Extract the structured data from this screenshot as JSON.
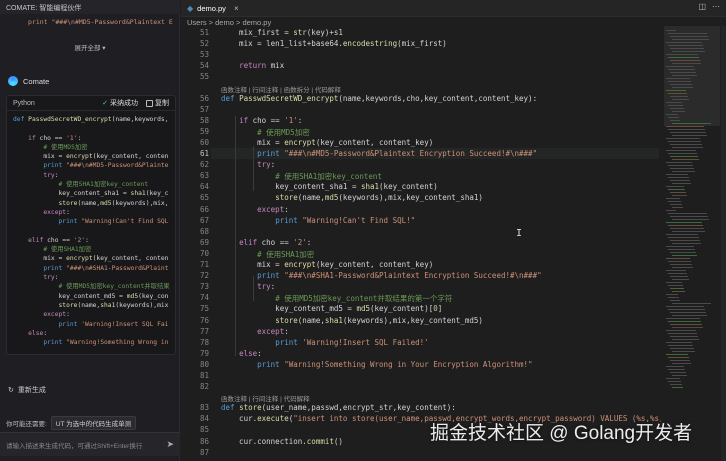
{
  "left_panel": {
    "title": "COMATE: 智能编程伙伴",
    "prev_code": "print \"###\\n#MD5-Password&Plaintext E",
    "expand_label": "展开全部",
    "assistant_name": "Comate",
    "code_block": {
      "language": "Python",
      "adopt_label": "采纳成功",
      "copy_label": "复制",
      "lines": [
        "def PasswdSecretWD_encrypt(name,keywords,",
        "",
        "    if cho == '1':",
        "        # 使用MD5加密",
        "        mix = encrypt(key_content, conten",
        "        print \"###\\n#MD5-Password&Plainte",
        "        try:",
        "            # 使用SHA1加密key_content",
        "            key_content_sha1 = sha1(key_c",
        "            store(name,md5(keywords),mix,",
        "        except:",
        "            print \"Warning!Can't Find SQL",
        "",
        "    elif cho == '2':",
        "        # 使用SHA1加密",
        "        mix = encrypt(key_content, conten",
        "        print \"###\\n#SHA1-Password&Plaint",
        "        try:",
        "            # 使用MD5加密key_content并取结果",
        "            key_content_md5 = md5(key_con",
        "            store(name,sha1(keywords),mix",
        "        except:",
        "            print 'Warning!Insert SQL Fai",
        "    else:",
        "        print \"Warning!Something Wrong in"
      ]
    },
    "regenerate_label": "重新生成",
    "ask_label": "你可能还需要:",
    "ask_chip": "UT 为选中的代码生成单测",
    "input_placeholder": "请输入描述来生成代码，可通过Shift+Enter换行"
  },
  "editor": {
    "tab_label": "demo.py",
    "breadcrumb": "Users > demo > demo.py",
    "lens_1": "函数注释 | 行间注释 | 函数拆分 | 代码解释",
    "lens_2": "函数注释 | 行间注释 | 代码解释",
    "current_line": 61,
    "lines": [
      {
        "n": "51",
        "t": "    mix_first = str(key)+s1"
      },
      {
        "n": "52",
        "t": "    mix = len1_list+base64.encodestring(mix_first)"
      },
      {
        "n": "53",
        "t": ""
      },
      {
        "n": "54",
        "t": "    return mix"
      },
      {
        "n": "55",
        "t": ""
      },
      {
        "n": "56",
        "t": "def PasswdSecretWD_encrypt(name,keywords,cho,key_content,content_key):"
      },
      {
        "n": "57",
        "t": ""
      },
      {
        "n": "58",
        "t": "    if cho == '1':"
      },
      {
        "n": "59",
        "t": "        # 使用MD5加密"
      },
      {
        "n": "60",
        "t": "        mix = encrypt(key_content, content_key)"
      },
      {
        "n": "61",
        "t": "        print \"###\\n#MD5-Password&Plaintext Encryption Succeed!#\\n###\""
      },
      {
        "n": "62",
        "t": "        try:"
      },
      {
        "n": "63",
        "t": "            # 使用SHA1加密key_content"
      },
      {
        "n": "64",
        "t": "            key_content_sha1 = sha1(key_content)"
      },
      {
        "n": "65",
        "t": "            store(name,md5(keywords),mix,key_content_sha1)"
      },
      {
        "n": "66",
        "t": "        except:"
      },
      {
        "n": "67",
        "t": "            print \"Warning!Can't Find SQL!\""
      },
      {
        "n": "68",
        "t": ""
      },
      {
        "n": "69",
        "t": "    elif cho == '2':"
      },
      {
        "n": "70",
        "t": "        # 使用SHA1加密"
      },
      {
        "n": "71",
        "t": "        mix = encrypt(key_content, content_key)"
      },
      {
        "n": "72",
        "t": "        print \"###\\n#SHA1-Password&Plaintext Encryption Succeed!#\\n###\""
      },
      {
        "n": "73",
        "t": "        try:"
      },
      {
        "n": "74",
        "t": "            # 使用MD5加密key_content并取结果的第一个字符"
      },
      {
        "n": "75",
        "t": "            key_content_md5 = md5(key_content)[0]"
      },
      {
        "n": "76",
        "t": "            store(name,sha1(keywords),mix,key_content_md5)"
      },
      {
        "n": "77",
        "t": "        except:"
      },
      {
        "n": "78",
        "t": "            print 'Warning!Insert SQL Failed!'"
      },
      {
        "n": "79",
        "t": "    else:"
      },
      {
        "n": "80",
        "t": "        print \"Warning!Something Wrong in Your Encryption Algorithm!\""
      },
      {
        "n": "81",
        "t": ""
      },
      {
        "n": "82",
        "t": ""
      },
      {
        "n": "83",
        "t": "def store(user_name,passwd,encrypt_str,key_content):"
      },
      {
        "n": "84",
        "t": "    cur.execute(\"insert into store(user_name,passwd,encrypt_words,encrypt_password) VALUES (%s,%s,%s"
      },
      {
        "n": "85",
        "t": ""
      },
      {
        "n": "86",
        "t": "    cur.connection.commit()"
      },
      {
        "n": "87",
        "t": ""
      }
    ]
  },
  "watermark": "掘金技术社区 @ Golang开发者",
  "colors": {
    "keyword": "#569cd6",
    "function": "#dcdcaa",
    "string": "#ce9178",
    "comment": "#6a9955",
    "number": "#b5cea8"
  }
}
